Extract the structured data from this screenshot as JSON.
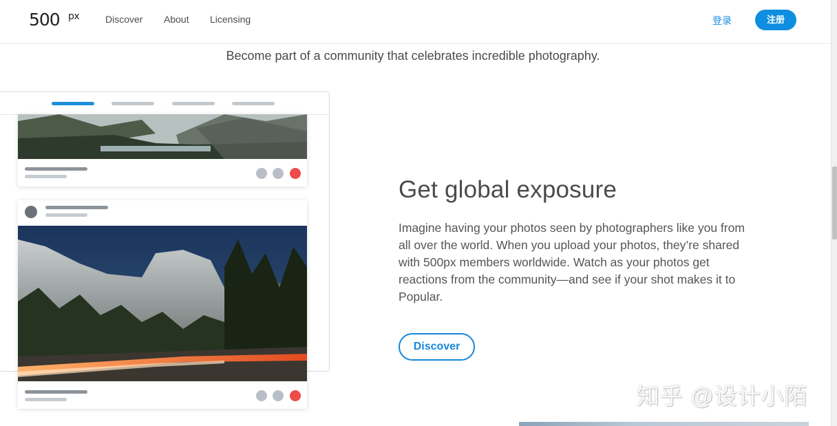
{
  "header": {
    "logo_main": "500",
    "logo_sup": "px",
    "nav": [
      "Discover",
      "About",
      "Licensing"
    ],
    "login_label": "登录",
    "signup_label": "注册"
  },
  "tagline": "Become part of a community that celebrates incredible photography.",
  "feature": {
    "title": "Get global exposure",
    "body": "Imagine having your photos seen by photographers like you from all over the world. When you upload your photos, they’re shared with 500px members worldwide. Watch as your photos get reactions from the community—and see if your shot makes it to Popular.",
    "button_label": "Discover"
  },
  "watermark": "知乎 @设计小陌",
  "colors": {
    "accent": "#0e8ee0",
    "reaction_red": "#ee4b4b"
  }
}
